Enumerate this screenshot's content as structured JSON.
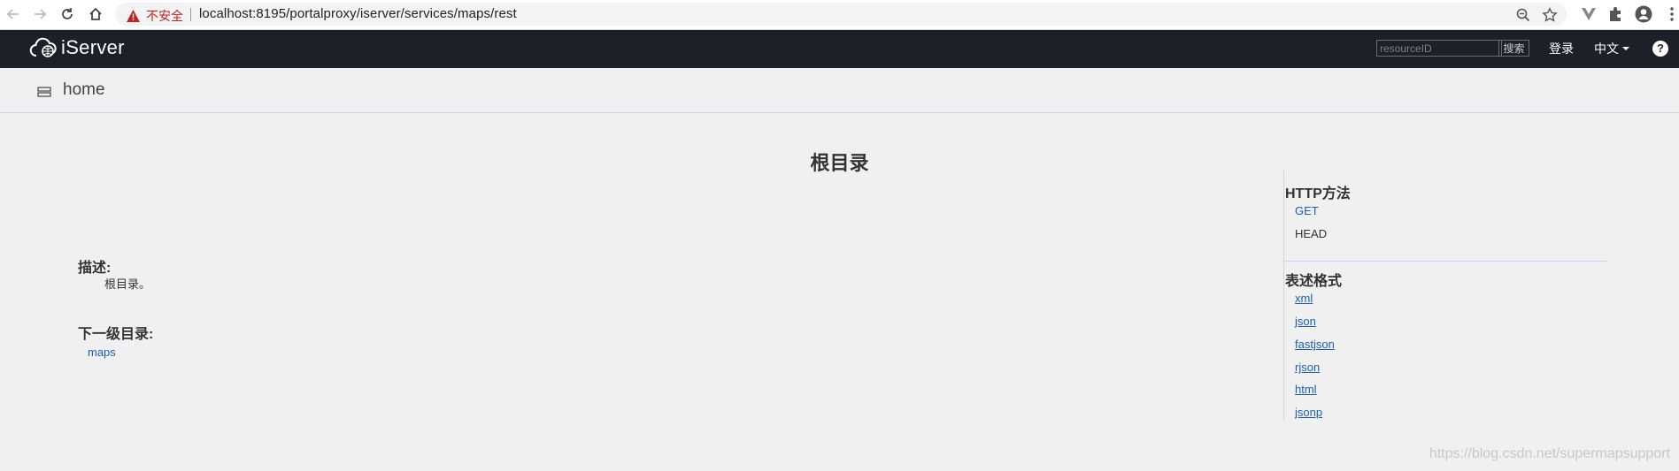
{
  "browser": {
    "security_label": "不安全",
    "url": "localhost:8195/portalproxy/iserver/services/maps/rest"
  },
  "header": {
    "brand": "iServer",
    "search_placeholder": "resourceID",
    "search_button": "搜索",
    "login": "登录",
    "language": "中文",
    "help": "?"
  },
  "breadcrumb": {
    "label": "home"
  },
  "main": {
    "title": "根目录",
    "description_label": "描述:",
    "description": "根目录。",
    "children_label": "下一级目录:",
    "children": [
      "maps"
    ]
  },
  "sidebar": {
    "http_title": "HTTP方法",
    "http_methods": [
      {
        "label": "GET",
        "link": true
      },
      {
        "label": "HEAD",
        "link": false
      }
    ],
    "formats_title": "表述格式",
    "formats": [
      "xml",
      "json",
      "fastjson",
      "rjson",
      "html",
      "jsonp"
    ]
  },
  "watermark": "https://blog.csdn.net/supermapsupport",
  "colors": {
    "appbar": "#1c2029",
    "link": "#1a5fb4",
    "background": "#f0f0f0",
    "warning": "#c5221f"
  }
}
